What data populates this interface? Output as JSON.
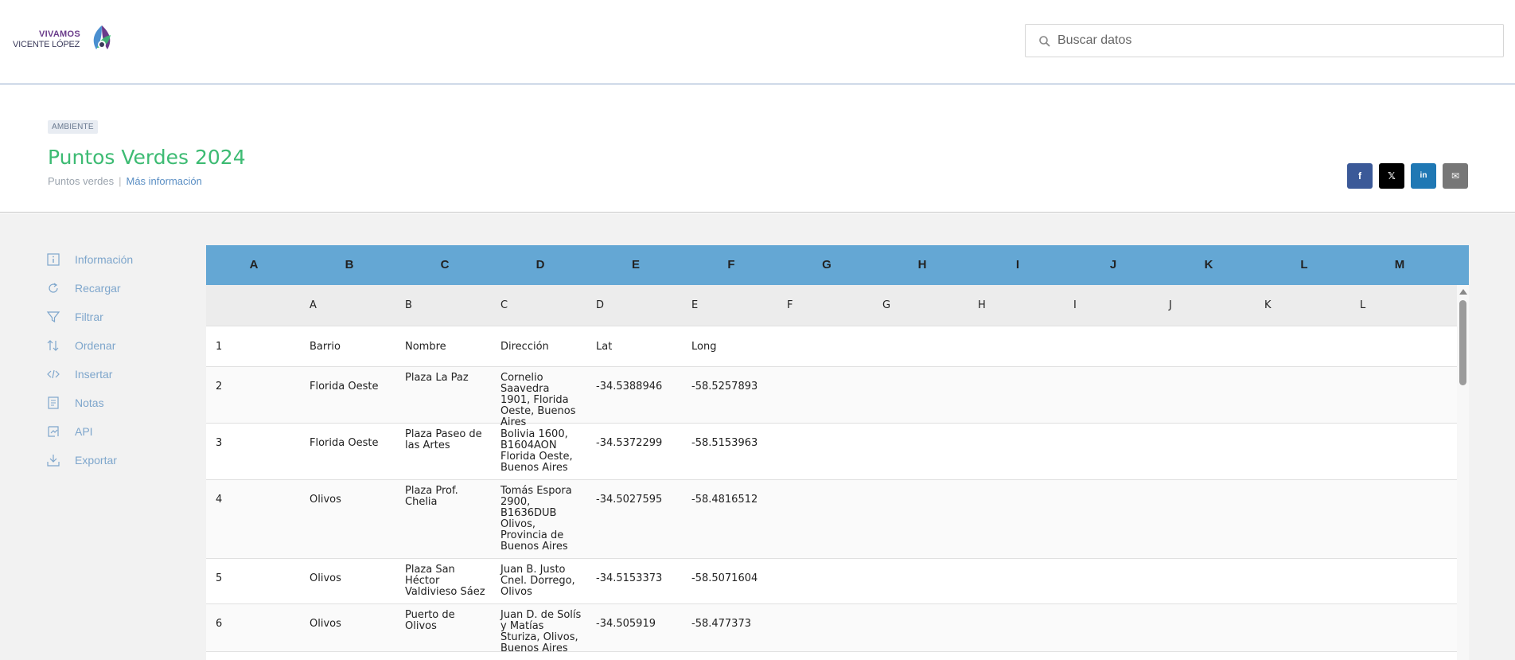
{
  "header": {
    "logo_line1": "VIVAMOS",
    "logo_line2": "VICENTE LÓPEZ",
    "search_placeholder": "Buscar datos"
  },
  "dataset": {
    "category": "AMBIENTE",
    "title": "Puntos Verdes 2024",
    "subtitle": "Puntos verdes",
    "more_info": "Más información"
  },
  "share": [
    {
      "name": "facebook",
      "glyph": "f",
      "color": "#3b5998"
    },
    {
      "name": "x",
      "glyph": "𝕏",
      "color": "#000000"
    },
    {
      "name": "linkedin",
      "glyph": "in",
      "color": "#1f78b4"
    },
    {
      "name": "email",
      "glyph": "✉",
      "color": "#777777"
    }
  ],
  "sidebar": {
    "items": [
      {
        "label": "Información",
        "icon": "info-icon"
      },
      {
        "label": "Recargar",
        "icon": "reload-icon"
      },
      {
        "label": "Filtrar",
        "icon": "filter-icon"
      },
      {
        "label": "Ordenar",
        "icon": "sort-icon"
      },
      {
        "label": "Insertar",
        "icon": "embed-icon"
      },
      {
        "label": "Notas",
        "icon": "notes-icon"
      },
      {
        "label": "API",
        "icon": "api-icon"
      },
      {
        "label": "Exportar",
        "icon": "export-icon"
      }
    ]
  },
  "table": {
    "sheet_columns": [
      "A",
      "B",
      "C",
      "D",
      "E",
      "F",
      "G",
      "H",
      "I",
      "J",
      "K",
      "L",
      "M"
    ],
    "data_columns": [
      "A",
      "B",
      "C",
      "D",
      "E",
      "F",
      "G",
      "H",
      "I",
      "J",
      "K",
      "L"
    ],
    "rows": [
      [
        "1",
        "Barrio",
        "Nombre",
        "Dirección",
        "Lat",
        "Long"
      ],
      [
        "2",
        "Florida Oeste",
        "Plaza La Paz",
        "Cornelio Saavedra 1901, Florida Oeste, Buenos Aires",
        "-34.5388946",
        "-58.5257893"
      ],
      [
        "3",
        "Florida Oeste",
        "Plaza Paseo de las Artes",
        "Bolivia 1600, B1604AON Florida Oeste, Buenos Aires",
        "-34.5372299",
        "-58.5153963"
      ],
      [
        "4",
        "Olivos",
        "Plaza Prof. Chelia",
        "Tomás Espora 2900, B1636DUB Olivos, Provincia de Buenos Aires",
        "-34.5027595",
        "-58.4816512"
      ],
      [
        "5",
        "Olivos",
        "Plaza San Héctor Valdivieso Sáez",
        "Juan B. Justo Cnel. Dorrego, Olivos",
        "-34.5153373",
        "-58.5071604"
      ],
      [
        "6",
        "Olivos",
        "Puerto de Olivos",
        "Juan D. de Solís y Matías Sturiza, Olivos, Buenos Aires",
        "-34.505919",
        "-58.477373"
      ]
    ]
  },
  "colors": {
    "accent_green": "#3dbb73",
    "header_blue": "#64a7d4",
    "link_blue": "#5b8fc4"
  }
}
